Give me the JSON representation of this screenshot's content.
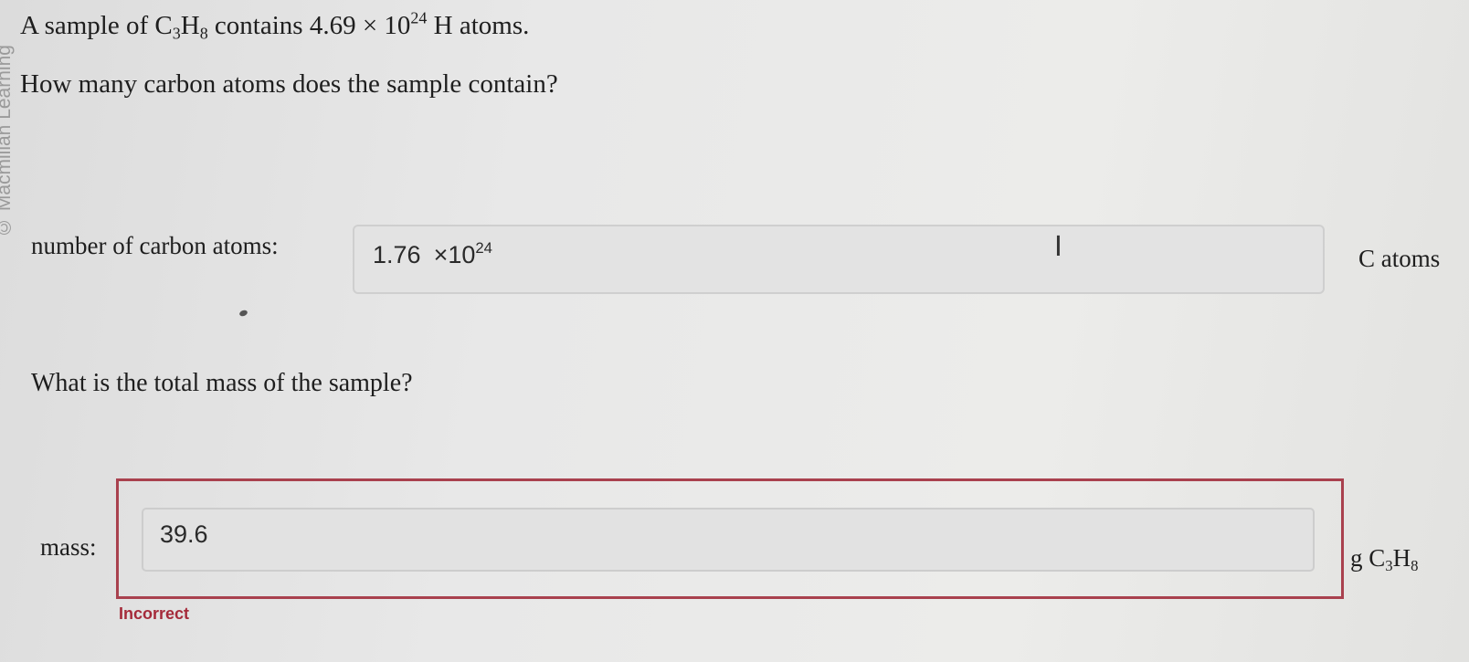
{
  "watermark": "© Macmillan Learning",
  "question1": {
    "prefix": "A sample of ",
    "c": "C",
    "c_sub": "3",
    "h": "H",
    "h_sub": "8",
    "middle": " contains 4.69 × 10",
    "exp": "24",
    "suffix": " H atoms."
  },
  "question2": "How many carbon atoms does the sample contain?",
  "carbon": {
    "label": "number of carbon atoms:",
    "value": "1.76",
    "times": "×10",
    "exponent": "24",
    "unit": "C atoms"
  },
  "question3": "What is the total mass of the sample?",
  "mass": {
    "label": "mass:",
    "value": "39.6",
    "unit_prefix": "g C",
    "unit_c_sub": "3",
    "unit_h": "H",
    "unit_h_sub": "8",
    "feedback": "Incorrect"
  },
  "colors": {
    "error_border": "#a9414e",
    "error_text": "#a52a3a"
  },
  "icons": {
    "cursor": "text-cursor-icon"
  }
}
